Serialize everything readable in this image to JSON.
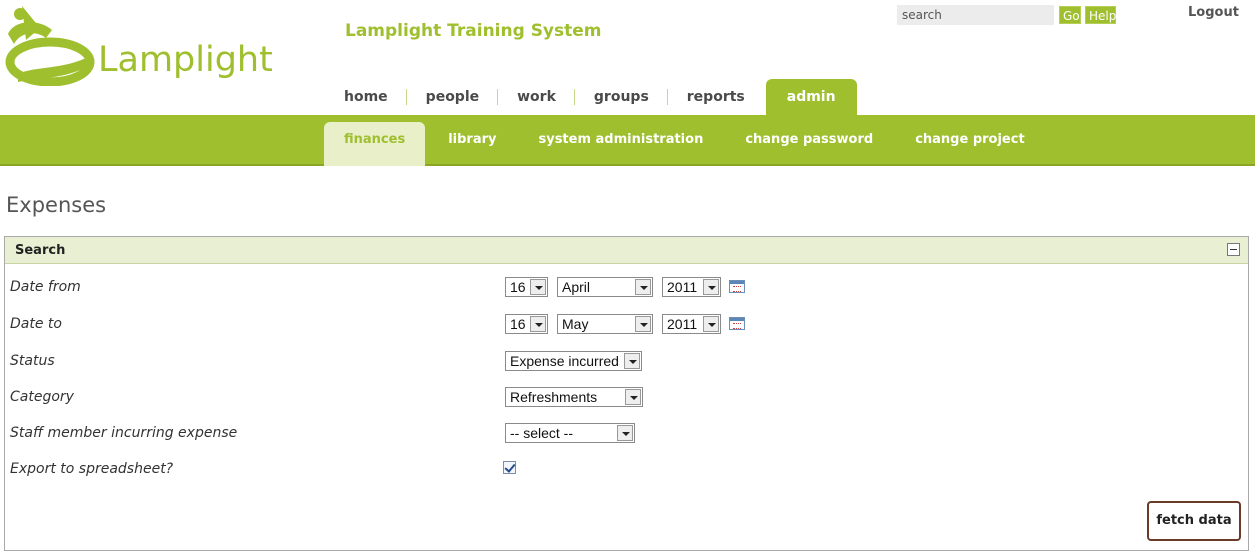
{
  "header": {
    "logo_text": "Lamplight",
    "app_title": "Lamplight Training System",
    "search": {
      "placeholder": "search",
      "value": "search"
    },
    "go_label": "Go",
    "help_label": "Help",
    "logout_label": "Logout"
  },
  "main_nav": {
    "items": [
      {
        "label": "home"
      },
      {
        "label": "people"
      },
      {
        "label": "work"
      },
      {
        "label": "groups"
      },
      {
        "label": "reports"
      },
      {
        "label": "admin"
      }
    ],
    "active": "admin"
  },
  "sub_nav": {
    "items": [
      {
        "label": "finances"
      },
      {
        "label": "library"
      },
      {
        "label": "system administration"
      },
      {
        "label": "change password"
      },
      {
        "label": "change project"
      }
    ],
    "active": "finances"
  },
  "page": {
    "title": "Expenses"
  },
  "search_panel": {
    "title": "Search",
    "fields": {
      "date_from": {
        "label": "Date from",
        "day": "16",
        "month": "April",
        "year": "2011"
      },
      "date_to": {
        "label": "Date to",
        "day": "16",
        "month": "May",
        "year": "2011"
      },
      "status": {
        "label": "Status",
        "value": "Expense incurred"
      },
      "category": {
        "label": "Category",
        "value": "Refreshments"
      },
      "staff": {
        "label": "Staff member incurring expense",
        "value": "-- select --"
      },
      "export": {
        "label": "Export to spreadsheet?",
        "checked": true
      }
    },
    "fetch_label": "fetch data"
  },
  "colors": {
    "brand_green": "#9fbf2e",
    "panel_header": "#e8efd2",
    "fetch_border": "#6b3b2a"
  }
}
